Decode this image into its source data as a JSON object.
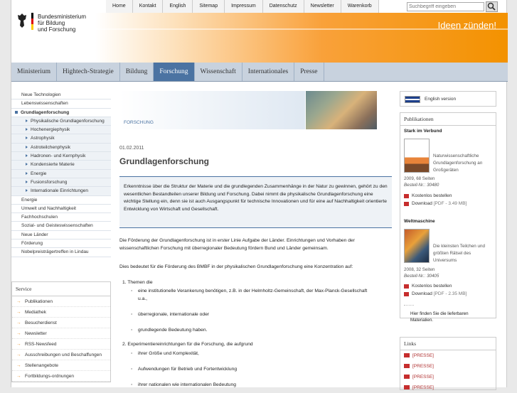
{
  "header": {
    "logo_lines": [
      "Bundesministerium",
      "für Bildung",
      "und Forschung"
    ],
    "slogan": "Ideen zünden!",
    "search_placeholder": "Suchbegriff eingeben"
  },
  "topnav": [
    "Home",
    "Kontakt",
    "English",
    "Sitemap",
    "Impressum",
    "Datenschutz",
    "Newsletter",
    "Warenkorb"
  ],
  "mainnav": {
    "items": [
      "Ministerium",
      "Hightech-Strategie",
      "Bildung",
      "Forschung",
      "Wissenschaft",
      "Internationales",
      "Presse"
    ],
    "active": "Forschung"
  },
  "leftnav": [
    {
      "label": "Neue Technologien",
      "level": 1
    },
    {
      "label": "Lebenswissenschaften",
      "level": 1
    },
    {
      "label": "Grundlagenforschung",
      "level": 1,
      "current": true
    },
    {
      "label": "Physikalische Grundlagenforschung",
      "level": 2
    },
    {
      "label": "Hochenergiephysik",
      "level": 2
    },
    {
      "label": "Astrophysik",
      "level": 2
    },
    {
      "label": "Astroteilchenphysik",
      "level": 2
    },
    {
      "label": "Hadronen- und Kernphysik",
      "level": 2
    },
    {
      "label": "Kondensierte Materie",
      "level": 2
    },
    {
      "label": "Energie",
      "level": 2
    },
    {
      "label": "Fusionsforschung",
      "level": 2
    },
    {
      "label": "Internationale Einrichtungen",
      "level": 2
    },
    {
      "label": "Energie",
      "level": 1
    },
    {
      "label": "Umwelt und Nachhaltigkeit",
      "level": 1
    },
    {
      "label": "Fachhochschulen",
      "level": 1
    },
    {
      "label": "Sozial- und Geisteswissenschaften",
      "level": 1
    },
    {
      "label": "Neue Länder",
      "level": 1
    },
    {
      "label": "Förderung",
      "level": 1
    },
    {
      "label": "Nobelpreisträgertreffen in Lindau",
      "level": 1
    }
  ],
  "service": {
    "title": "Service",
    "items": [
      "Publikationen",
      "Mediathek",
      "Besucherdienst",
      "Newsletter",
      "RSS-Newsfeed",
      "Ausschreibungen und Beschaffungen",
      "Stellenangebote",
      "Fortbildungs-ordnungen"
    ]
  },
  "content": {
    "kicker": "FORSCHUNG",
    "date": "01.02.2011",
    "title": "Grundlagenforschung",
    "lead": "Erkenntnisse über die Struktur der Materie und die grundlegenden Zusammenhänge in der Natur zu gewinnen, gehört zu den wesentlichen Bestandteilen unserer Bildung und Forschung. Dabei nimmt die physikalische Grundlagenforschung eine wichtige Stellung ein, denn sie ist auch Ausgangspunkt für technische Innovationen und für eine auf Nachhaltigkeit orientierte Entwicklung von Wirtschaft und Gesellschaft.",
    "p1": "Die Förderung der Grundlagenforschung ist in erster Linie Aufgabe der Länder. Einrichtungen und Vorhaben der wissenschaftlichen Forschung mit überregionaler Bedeutung fördern Bund und Länder gemeinsam.",
    "p2": "Dies bedeutet für die Förderung des BMBF in der physikalischen Grundlagenforschung eine Konzentration auf:",
    "item1": "1.  Themen die",
    "item1_bullets": [
      "eine institutionelle Verankerung benötigen, z.B. in der Helmholtz-Gemeinschaft, der Max-Planck-Gesellschaft u.a.,",
      "überregionale, internationale oder",
      "grundlegende Bedeutung haben."
    ],
    "item2": "2.  Experimentiereinrichtungen für die Forschung, die aufgrund",
    "item2_bullets": [
      "ihrer Größe und Komplexität,",
      "Aufwendungen für Betrieb und Fortentwicklung",
      "ihrer nationalen wie internationalen Bedeutung"
    ]
  },
  "right": {
    "english": "English version",
    "publications_title": "Publikationen",
    "books": [
      {
        "heading": "Stark im Verbund",
        "desc": "Naturwissenschaftliche Grundlagenforschung an Großgeräten",
        "pages": "2009, 68 Seiten",
        "order_no": "Bestell-Nr.: 30480",
        "order": "Kostenlos bestellen",
        "download": "Download",
        "size": "[PDF - 3.49 MB]"
      },
      {
        "heading": "Weltmaschine",
        "desc": "Die kleinsten Teilchen und größten Rätsel des Universums",
        "pages": "2008, 32 Seiten",
        "order_no": "Bestell-Nr.: 30405",
        "order": "Kostenlos bestellen",
        "download": "Download",
        "size": "[PDF - 2.35 MB]"
      }
    ],
    "all_pubs": "Hier finden Sie die lieferbaren Materialien.",
    "links_title": "Links",
    "links": [
      "[PRESSE]",
      "[PRESSE]",
      "[PRESSE]",
      "[PRESSE]"
    ]
  },
  "colors": {
    "accent": "#4b73a2",
    "banner": "#f39200",
    "link_red": "#b03030"
  }
}
